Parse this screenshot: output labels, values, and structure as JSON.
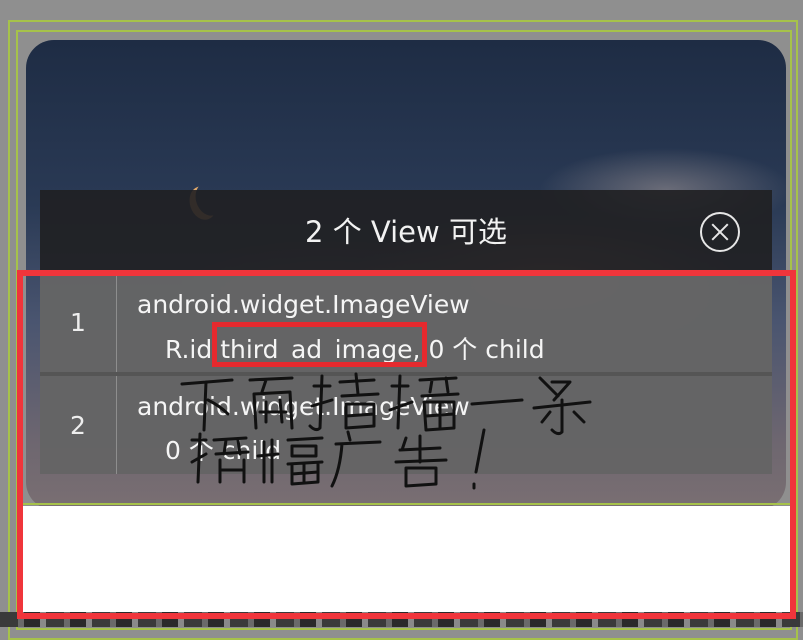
{
  "dialog": {
    "title": "2 个 View 可选",
    "close_icon": "close-circle-icon",
    "items": [
      {
        "index": "1",
        "class_name": "android.widget.ImageView",
        "detail": "R.id third_ad_image, 0 个 child"
      },
      {
        "index": "2",
        "class_name": "android.widget.ImageView",
        "detail": "0 个 child"
      }
    ]
  },
  "annotation_text": "下面插播一条横幅广告!",
  "colors": {
    "highlight_red": "#f0353b",
    "layout_outline_green": "#a6c24a",
    "dialog_background": "#28282a"
  }
}
